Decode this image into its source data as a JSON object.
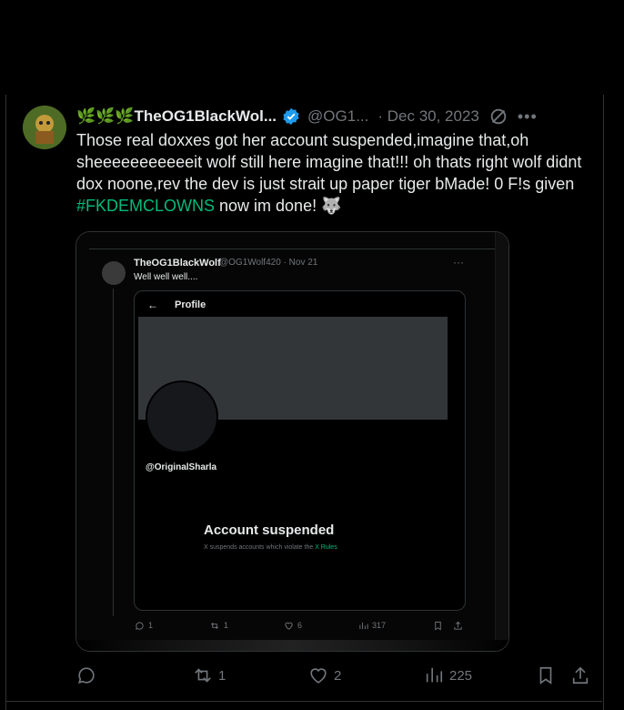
{
  "tweet": {
    "emojis": "🌿🌿🌿",
    "display_name": "TheOG1BlackWol...",
    "handle": "@OG1...",
    "date": "· Dec 30, 2023",
    "text_part1": "Those real doxxes got her account suspended,imagine that,oh sheeeeeeeeeeeit  wolf still here imagine that!!! oh thats right wolf didnt dox noone,rev the dev is just strait up paper tiger bMade! 0 F!s given ",
    "hashtag": "#FKDEMCLOWNS",
    "text_part2": " now im done! 🐺",
    "accent_color": "#00ba7c"
  },
  "embedded_screenshot": {
    "author_name": "TheOG1BlackWolf",
    "author_meta": "@OG1Wolf420 · Nov 21",
    "text": "Well well well....",
    "profile_header": "Profile",
    "back_arrow": "←",
    "profile_handle": "@OriginalSharla",
    "suspended_title": "Account suspended",
    "suspended_sub": "X suspends accounts which violate the ",
    "rules_link": "X Rules",
    "replies": "1",
    "reposts": "1",
    "likes": "6",
    "views": "317"
  },
  "actions": {
    "replies": "",
    "reposts": "1",
    "likes": "2",
    "views": "225"
  },
  "icons": [
    "verified-icon",
    "grok-icon",
    "more-icon",
    "reply-icon",
    "repost-icon",
    "like-icon",
    "views-icon",
    "bookmark-icon",
    "share-icon"
  ]
}
